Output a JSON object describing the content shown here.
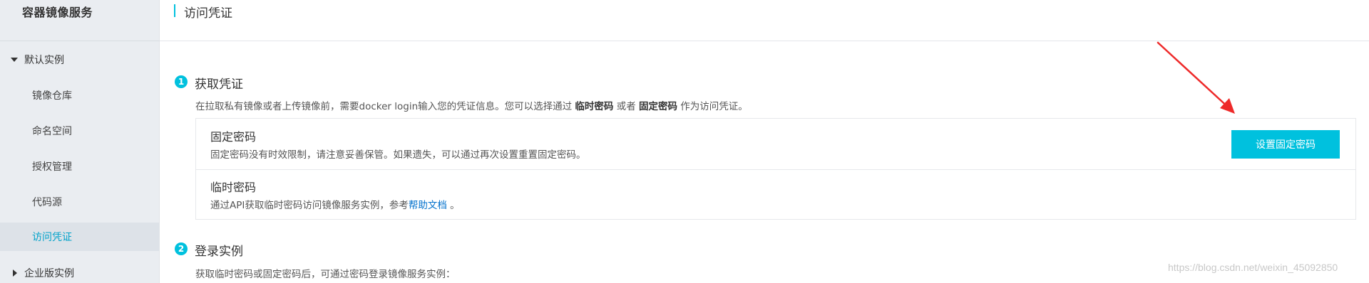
{
  "sidebar": {
    "title": "容器镜像服务",
    "groups": [
      {
        "label": "默认实例",
        "expanded": true
      },
      {
        "label": "企业版实例",
        "expanded": false
      }
    ],
    "items": [
      {
        "label": "镜像仓库",
        "active": false
      },
      {
        "label": "命名空间",
        "active": false
      },
      {
        "label": "授权管理",
        "active": false
      },
      {
        "label": "代码源",
        "active": false
      },
      {
        "label": "访问凭证",
        "active": true
      }
    ]
  },
  "header": {
    "title": "访问凭证"
  },
  "steps": [
    {
      "number": "1",
      "title": "获取凭证",
      "desc_prefix": "在拉取私有镜像或者上传镜像前，需要docker login输入您的凭证信息。您可以选择通过 ",
      "desc_bold1": "临时密码",
      "desc_mid": " 或者 ",
      "desc_bold2": "固定密码",
      "desc_suffix": " 作为访问凭证。"
    },
    {
      "number": "2",
      "title": "登录实例",
      "desc": "获取临时密码或固定密码后，可通过密码登录镜像服务实例："
    }
  ],
  "fixed_password": {
    "title": "固定密码",
    "desc": "固定密码没有时效限制，请注意妥善保管。如果遗失，可以通过再次设置重置固定密码。",
    "button_label": "设置固定密码"
  },
  "temp_password": {
    "title": "临时密码",
    "desc_prefix": "通过API获取临时密码访问镜像服务实例，参考",
    "link_label": "帮助文档",
    "desc_suffix": " 。"
  },
  "watermark": "https://blog.csdn.net/weixin_45092850",
  "colors": {
    "accent": "#00c1de",
    "link": "#0070cc",
    "sidebar_bg": "#eaedf1",
    "annotation_arrow": "#ee2a2a"
  }
}
